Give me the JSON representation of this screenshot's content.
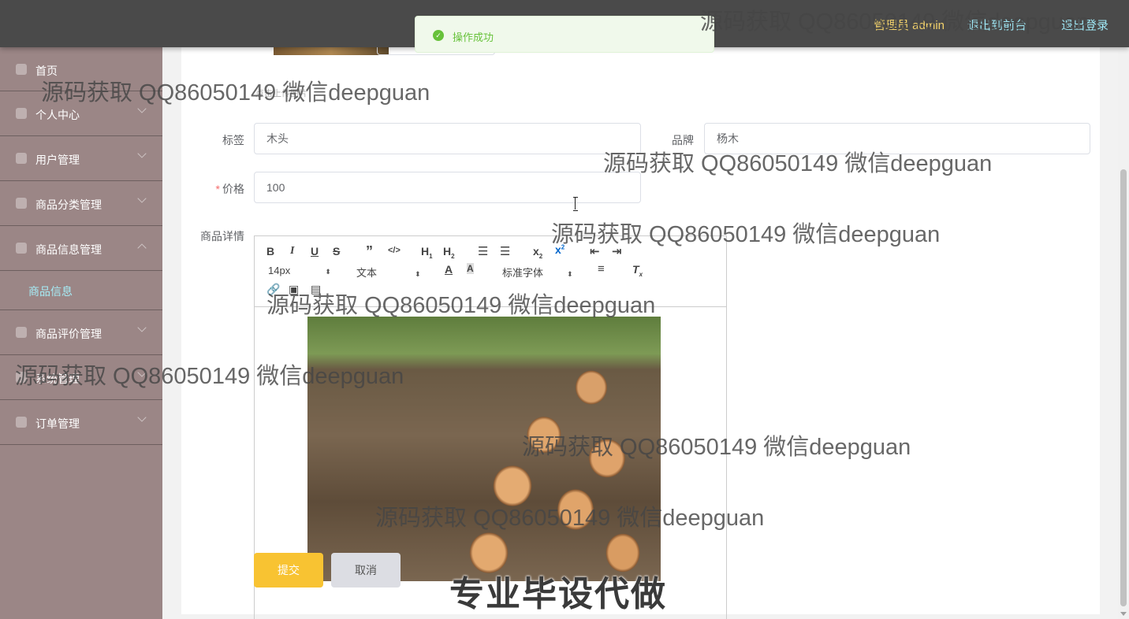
{
  "header": {
    "user_label": "管理员 admin",
    "back_to_front": "退出到前台",
    "logout": "退出登录"
  },
  "sidebar": {
    "items": [
      {
        "label": "首页",
        "icon": "home-icon"
      },
      {
        "label": "个人中心",
        "icon": "user-icon"
      },
      {
        "label": "用户管理",
        "icon": "users-icon"
      },
      {
        "label": "商品分类管理",
        "icon": "category-icon"
      },
      {
        "label": "商品信息管理",
        "icon": "goods-icon",
        "expanded": true
      },
      {
        "label": "商品评价管理",
        "icon": "comment-icon"
      },
      {
        "label": "系统管理",
        "icon": "settings-icon"
      },
      {
        "label": "订单管理",
        "icon": "order-icon"
      }
    ],
    "active_sub": "商品信息"
  },
  "toast": {
    "message": "操作成功",
    "type": "success"
  },
  "form": {
    "upload_tip": "点击上传图片",
    "tag_label": "标签",
    "tag_value": "木头",
    "brand_label": "品牌",
    "brand_value": "杨木",
    "price_label": "价格",
    "price_value": "100",
    "detail_label": "商品详情",
    "submit": "提交",
    "cancel": "取消"
  },
  "editor": {
    "font_size": "14px",
    "paragraph": "文本",
    "font_family": "标准字体",
    "image_content": "stacked cut logs in a forest"
  },
  "watermarks": {
    "text": "源码获取 QQ86050149 微信deepguan",
    "banner": "专业毕设代做"
  },
  "colors": {
    "sidebar_bg": "#9b8686",
    "header_bg": "#4a4a4a",
    "submit_bg": "#f8c332",
    "cancel_bg": "#dcdde3",
    "active_sub": "#a6ecf6",
    "toast_text": "#67c23a"
  }
}
